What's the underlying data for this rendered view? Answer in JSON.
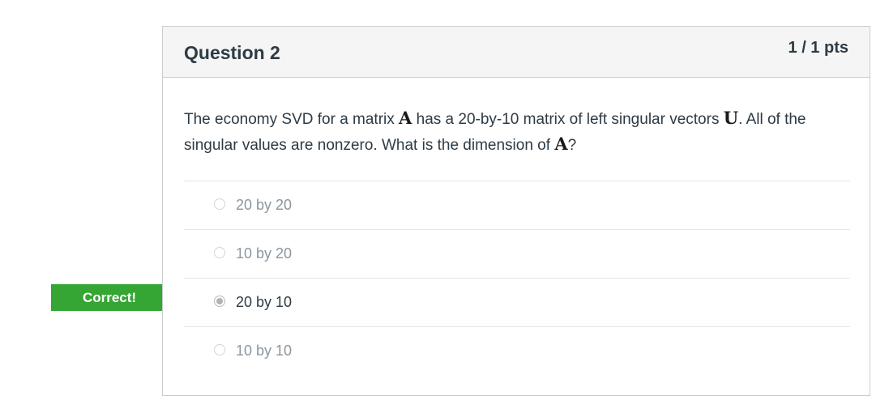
{
  "question": {
    "title": "Question 2",
    "points": "1 / 1 pts",
    "text_parts": [
      "The economy SVD for a matrix ",
      "A",
      " has a 20-by-10 matrix of left singular vectors ",
      "U",
      ".  All of the singular values are nonzero.  What is the dimension of ",
      "A",
      "?"
    ]
  },
  "answers": [
    {
      "label": "20 by 20",
      "selected": false
    },
    {
      "label": "10 by 20",
      "selected": false
    },
    {
      "label": "20 by 10",
      "selected": true
    },
    {
      "label": "10 by 10",
      "selected": false
    }
  ],
  "feedback": {
    "correct_label": "Correct!",
    "color": "#35a534"
  }
}
